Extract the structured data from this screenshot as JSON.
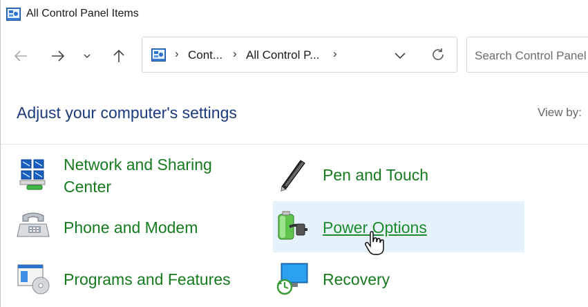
{
  "window": {
    "title": "All Control Panel Items",
    "title_icon": "control-panel-icon"
  },
  "nav": {
    "back_icon": "arrow-left-icon",
    "forward_icon": "arrow-right-icon",
    "recent_icon": "chevron-down-icon",
    "up_icon": "arrow-up-icon"
  },
  "address": {
    "icon": "control-panel-icon",
    "separator": "›",
    "crumbs": [
      "Cont...",
      "All Control P..."
    ],
    "dropdown_icon": "chevron-down-icon",
    "refresh_icon": "refresh-icon"
  },
  "search": {
    "placeholder": "Search Control Panel"
  },
  "header": {
    "heading": "Adjust your computer's settings",
    "view_by_label": "View by:"
  },
  "items": [
    {
      "label_line1": "Network and Sharing",
      "label_line2": "Center",
      "icon": "network-sharing-icon"
    },
    {
      "label": "Pen and Touch",
      "icon": "pen-touch-icon"
    },
    {
      "label": "Phone and Modem",
      "icon": "phone-modem-icon"
    },
    {
      "label": "Power Options",
      "icon": "power-battery-icon",
      "state": "hovered"
    },
    {
      "label": "Programs and Features",
      "icon": "programs-features-icon"
    },
    {
      "label": "Recovery",
      "icon": "recovery-icon"
    }
  ],
  "colors": {
    "heading": "#1a3a7a",
    "link": "#157a1d",
    "hover_bg": "#e5f1fb"
  }
}
